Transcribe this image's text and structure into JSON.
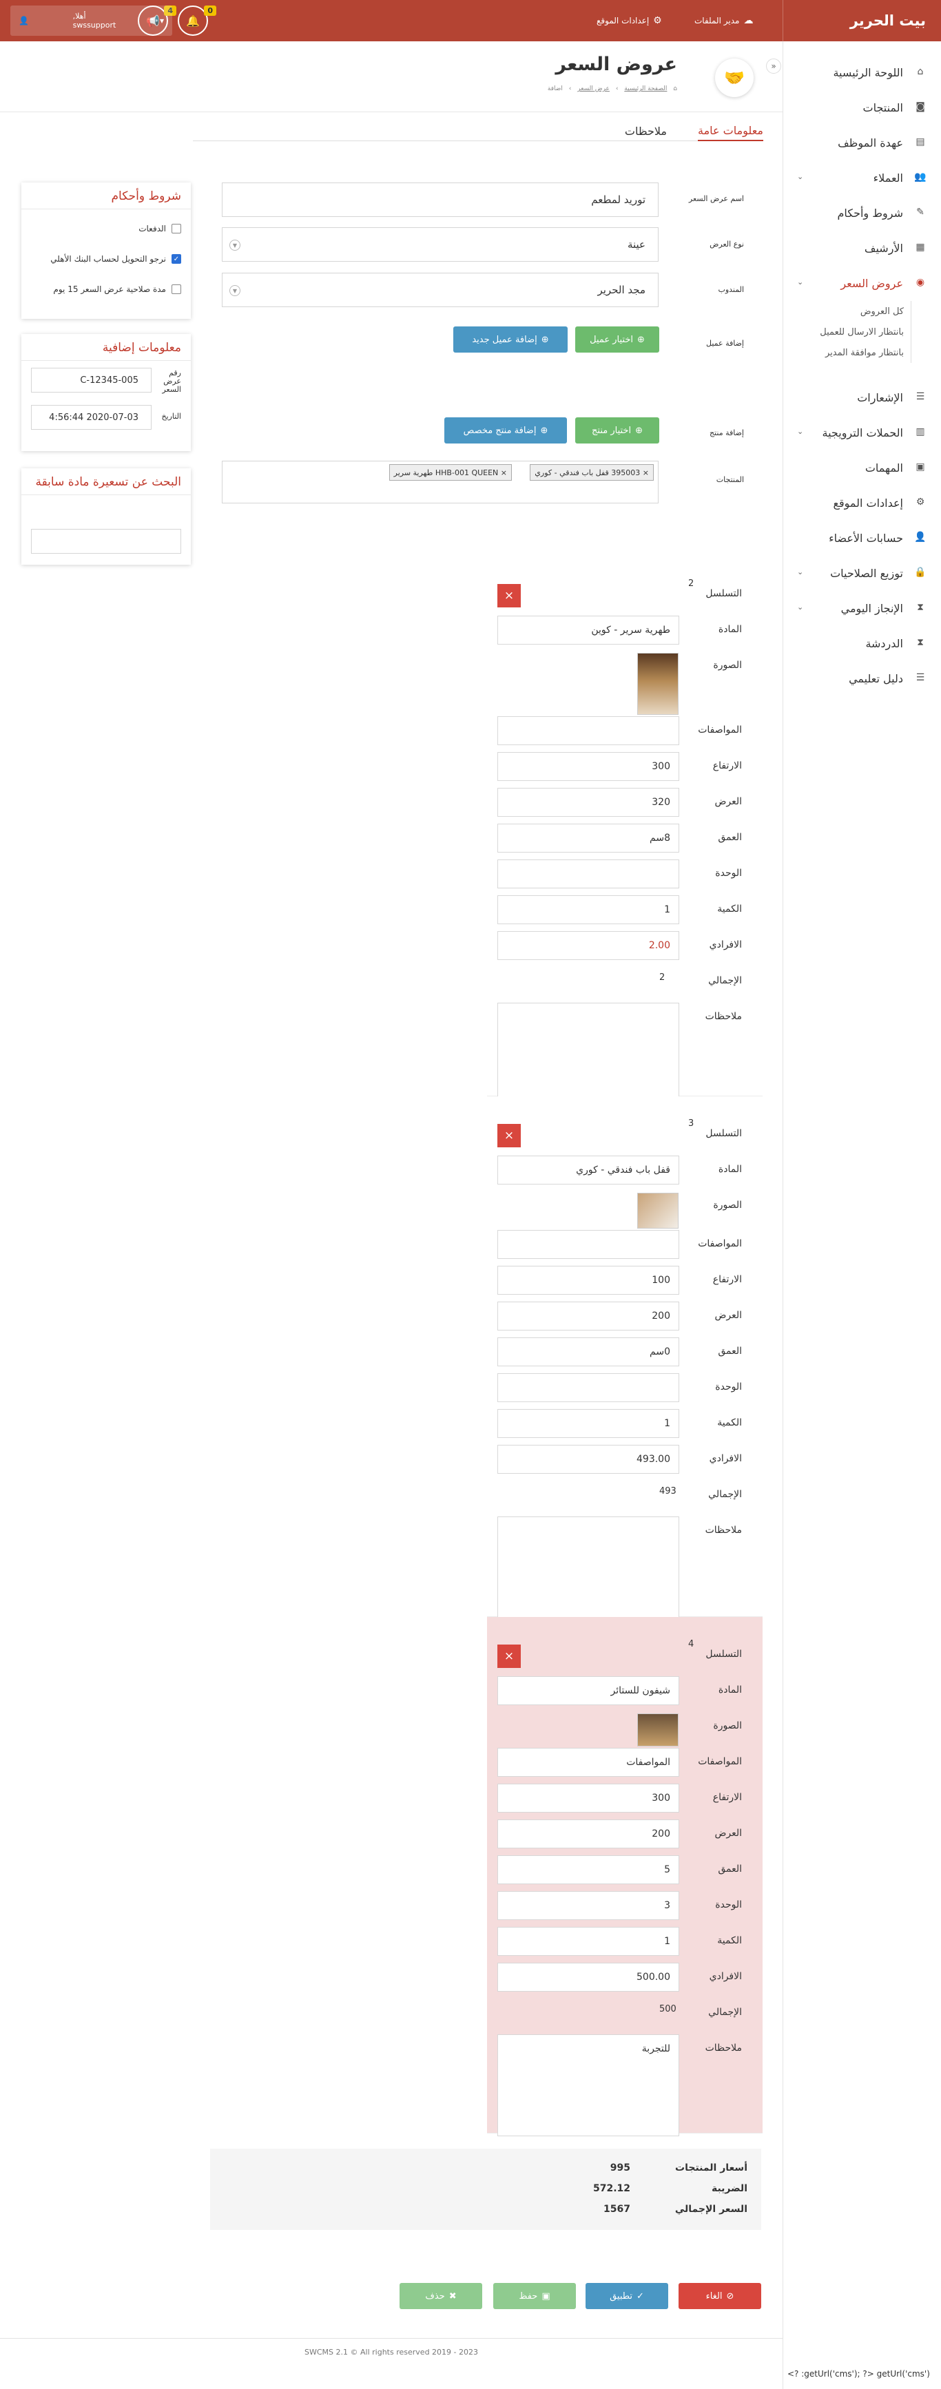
{
  "topbar": {
    "brand": "بيت الحرير",
    "file_manager": "مدير الملفات",
    "site_settings": "إعدادات الموقع",
    "notif_count": "0",
    "announce_count": "4",
    "user_name": "أهلا,",
    "user_login": "swssupport"
  },
  "sidebar": {
    "items": [
      {
        "label": "اللوحة الرئيسية",
        "icon": "home-icon"
      },
      {
        "label": "المنتجات",
        "icon": "camera-icon"
      },
      {
        "label": "عهدة الموظف",
        "icon": "id-card-icon"
      },
      {
        "label": "العملاء",
        "icon": "users-icon"
      },
      {
        "label": "شروط وأحكام",
        "icon": "edit-icon"
      },
      {
        "label": "الأرشيف",
        "icon": "archive-icon"
      },
      {
        "label": "عروض السعر",
        "icon": "eye-icon"
      },
      {
        "label": "الإشعارات",
        "icon": "list-icon"
      },
      {
        "label": "الحملات الترويجية",
        "icon": "barcode-icon"
      },
      {
        "label": "المهمات",
        "icon": "tasks-icon"
      },
      {
        "label": "إعدادات الموقع",
        "icon": "gear-icon"
      },
      {
        "label": "حسابات الأعضاء",
        "icon": "user-icon"
      },
      {
        "label": "توزيع الصلاحيات",
        "icon": "lock-icon"
      },
      {
        "label": "الإنجاز اليومي",
        "icon": "hourglass-icon"
      },
      {
        "label": "الدردشة",
        "icon": "hourglass-icon"
      },
      {
        "label": "دليل تعليمي",
        "icon": "list-icon"
      }
    ],
    "sub_items": [
      "كل العروض",
      "بانتظار الارسال للعميل",
      "بانتظار موافقة المدير"
    ]
  },
  "page": {
    "title": "عروض السعر",
    "breadcrumb": [
      "الصفحة الرئيسية",
      "عرض السعر",
      "اضافة"
    ]
  },
  "tabs": [
    "معلومات عامة",
    "ملاحظات"
  ],
  "form": {
    "name_label": "اسم عرض السعر",
    "name_value": "توريد لمطعم",
    "type_label": "نوع العرض",
    "type_value": "عينة",
    "rep_label": "المندوب",
    "rep_value": "مجد الحرير",
    "add_client_label": "إضافة عميل",
    "choose_client": "اختيار عميل",
    "new_client": "إضافة عميل جديد",
    "add_product_label": "إضافة منتج",
    "choose_product": "اختيار منتج",
    "custom_product": "إضافة منتج مخصص",
    "products_label": "المنتجات",
    "tags": [
      "× 395003 قفل باب فندقي - كوري",
      "× HHB-001 QUEEN طهرية سرير"
    ]
  },
  "terms_panel": {
    "title": "شروط وأحكام",
    "items": [
      {
        "label": "الدفعات",
        "checked": false
      },
      {
        "label": "نرجو التحويل لحساب البنك الأهلي",
        "checked": true
      },
      {
        "label": "مدة صلاحية عرض السعر 15 يوم",
        "checked": false
      }
    ]
  },
  "extra_panel": {
    "title": "معلومات إضافية",
    "quote_no_label": "رقم عرض السعر",
    "quote_no": "C-12345-005",
    "date_label": "التاريخ",
    "date": "2020-07-03 4:56:44"
  },
  "search_panel": {
    "title": "البحث عن تسعيرة مادة سابقة",
    "placeholder": ""
  },
  "labels": {
    "seq": "التسلسل",
    "item": "المادة",
    "image": "الصورة",
    "specs": "المواصفات",
    "height": "الارتفاع",
    "width": "العرض",
    "depth": "العمق",
    "unit": "الوحدة",
    "qty": "الكمية",
    "price": "الافرادي",
    "total": "الإجمالي",
    "notes": "ملاحظات"
  },
  "cards": [
    {
      "seq": "2",
      "item": "طهرية سرير - كوين",
      "specs": "",
      "height": "300",
      "width": "320",
      "depth": "8سم",
      "unit": "",
      "qty": "1",
      "price": "2.00",
      "total": "2",
      "notes": "",
      "highlight": false
    },
    {
      "seq": "3",
      "item": "قفل باب فندقي - كوري",
      "specs": "",
      "height": "100",
      "width": "200",
      "depth": "0سم",
      "unit": "",
      "qty": "1",
      "price": "493.00",
      "total": "493",
      "notes": "",
      "highlight": false
    },
    {
      "seq": "4",
      "item": "شيفون للستائر",
      "specs": "المواصفات",
      "height": "300",
      "width": "200",
      "depth": "5",
      "unit": "3",
      "qty": "1",
      "price": "500.00",
      "total": "500",
      "notes": "للتجربة",
      "highlight": true
    }
  ],
  "totals": {
    "products_label": "أسعار المنتجات",
    "products": "995",
    "tax_label": "الضريبة",
    "tax": "572.12",
    "grand_label": "السعر الإجمالي",
    "grand": "1567"
  },
  "actions": {
    "cancel": "الغاء",
    "apply": "تطبيق",
    "save": "حفظ",
    "delete": "حذف"
  },
  "footer": "SWCMS 2.1 © All rights reserved 2019 - 2023",
  "bottom_text": "<? :getUrl('cms'); ?> getUrl('cms')",
  "colors": {
    "brand": "#b44433",
    "accent": "#c0392b",
    "green": "#6dbb6d",
    "blue": "#4a97c4",
    "highlight": "#f5dcdc"
  }
}
